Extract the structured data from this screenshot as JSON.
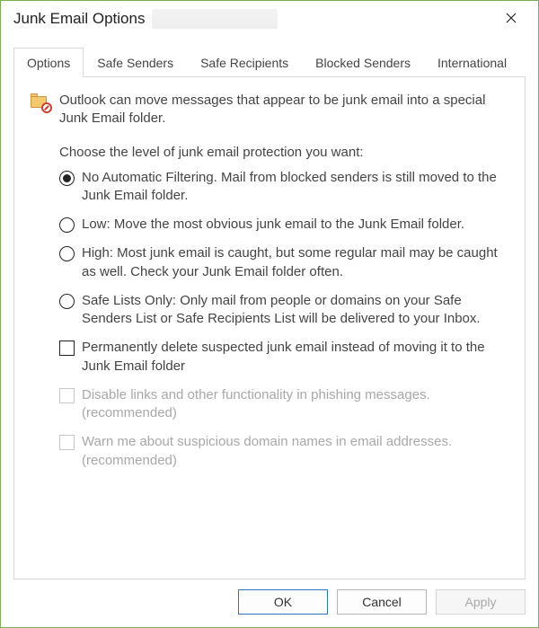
{
  "window": {
    "title": "Junk Email Options"
  },
  "tabs": [
    {
      "label": "Options",
      "active": true
    },
    {
      "label": "Safe Senders",
      "active": false
    },
    {
      "label": "Safe Recipients",
      "active": false
    },
    {
      "label": "Blocked Senders",
      "active": false
    },
    {
      "label": "International",
      "active": false
    }
  ],
  "panel": {
    "intro": "Outlook can move messages that appear to be junk email into a special Junk Email folder.",
    "choose": "Choose the level of junk email protection you want:",
    "radios": [
      {
        "label": "No Automatic Filtering. Mail from blocked senders is still moved to the Junk Email folder.",
        "selected": true
      },
      {
        "label": "Low: Move the most obvious junk email to the Junk Email folder.",
        "selected": false
      },
      {
        "label": "High: Most junk email is caught, but some regular mail may be caught as well. Check your Junk Email folder often.",
        "selected": false
      },
      {
        "label": "Safe Lists Only: Only mail from people or domains on your Safe Senders List or Safe Recipients List will be delivered to your Inbox.",
        "selected": false
      }
    ],
    "checks": [
      {
        "label": "Permanently delete suspected junk email instead of moving it to the Junk Email folder",
        "checked": false,
        "disabled": false
      },
      {
        "label": "Disable links and other functionality in phishing messages. (recommended)",
        "checked": false,
        "disabled": true
      },
      {
        "label": "Warn me about suspicious domain names in email addresses. (recommended)",
        "checked": false,
        "disabled": true
      }
    ]
  },
  "buttons": {
    "ok": "OK",
    "cancel": "Cancel",
    "apply": "Apply"
  }
}
